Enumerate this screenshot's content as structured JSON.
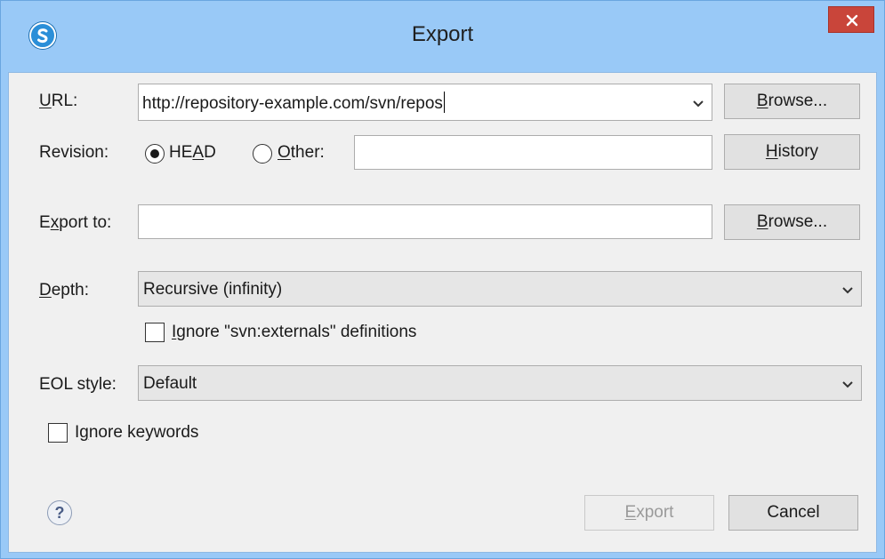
{
  "window": {
    "title": "Export",
    "close_label": "×"
  },
  "url": {
    "label_key": "U",
    "label_rest": "RL:",
    "value": "http://repository-example.com/svn/repos",
    "browse_key": "B",
    "browse_rest": "rowse..."
  },
  "revision": {
    "label": "Revision:",
    "head_pre": "HE",
    "head_key": "A",
    "head_post": "D",
    "head_selected": true,
    "other_key": "O",
    "other_rest": "ther:",
    "other_value": "",
    "history_key": "H",
    "history_rest": "istory"
  },
  "export_to": {
    "label_pre": "E",
    "label_key": "x",
    "label_rest": "port to:",
    "value": "",
    "browse_key": "B",
    "browse_rest": "rowse..."
  },
  "depth": {
    "label_key": "D",
    "label_rest": "epth:",
    "selected": "Recursive (infinity)",
    "ignore_externals_key": "I",
    "ignore_externals_rest": "gnore \"svn:externals\" definitions",
    "ignore_externals_checked": false
  },
  "eol": {
    "label": "EOL style:",
    "selected": "Default"
  },
  "ignore_keywords": {
    "label_pre": "I",
    "label_key": "g",
    "label_rest": "nore keywords",
    "checked": false
  },
  "footer": {
    "help_glyph": "?",
    "export_key": "E",
    "export_rest": "xport",
    "export_enabled": false,
    "cancel_label": "Cancel"
  },
  "colors": {
    "titlebar": "#99c9f7",
    "close_button": "#c9453a",
    "dialog_background": "#f0f0f0"
  }
}
